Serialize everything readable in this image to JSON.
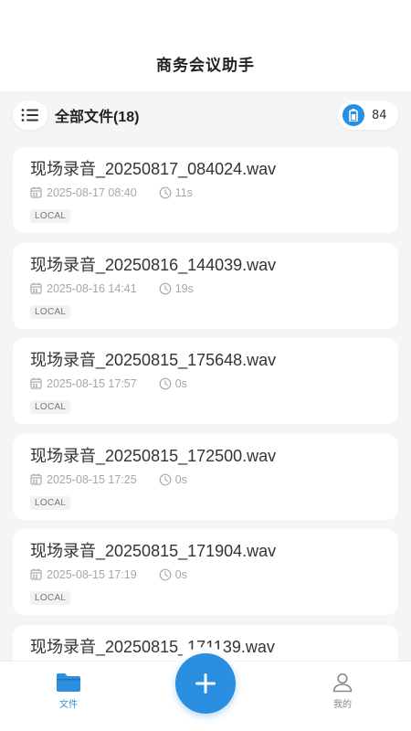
{
  "header": {
    "title": "商务会议助手"
  },
  "toolbar": {
    "title": "全部文件(18)",
    "battery_count": "84"
  },
  "files": [
    {
      "name": "现场录音_20250817_084024.wav",
      "date": "2025-08-17 08:40",
      "duration": "11s",
      "tag": "LOCAL"
    },
    {
      "name": "现场录音_20250816_144039.wav",
      "date": "2025-08-16 14:41",
      "duration": "19s",
      "tag": "LOCAL"
    },
    {
      "name": "现场录音_20250815_175648.wav",
      "date": "2025-08-15 17:57",
      "duration": "0s",
      "tag": "LOCAL"
    },
    {
      "name": "现场录音_20250815_172500.wav",
      "date": "2025-08-15 17:25",
      "duration": "0s",
      "tag": "LOCAL"
    },
    {
      "name": "现场录音_20250815_171904.wav",
      "date": "2025-08-15 17:19",
      "duration": "0s",
      "tag": "LOCAL"
    },
    {
      "name": "现场录音_20250815_171139.wav",
      "date": "",
      "duration": "",
      "tag": ""
    }
  ],
  "nav": {
    "files_label": "文件",
    "mine_label": "我的"
  },
  "icons": {
    "menu": "list-menu-icon",
    "battery": "battery-icon",
    "date": "calendar-icon",
    "duration": "clock-icon",
    "files": "folder-icon",
    "mine": "user-icon",
    "add": "plus-icon"
  },
  "colors": {
    "accent": "#2a8fe0",
    "background": "#f4f5f7",
    "card": "#ffffff"
  }
}
